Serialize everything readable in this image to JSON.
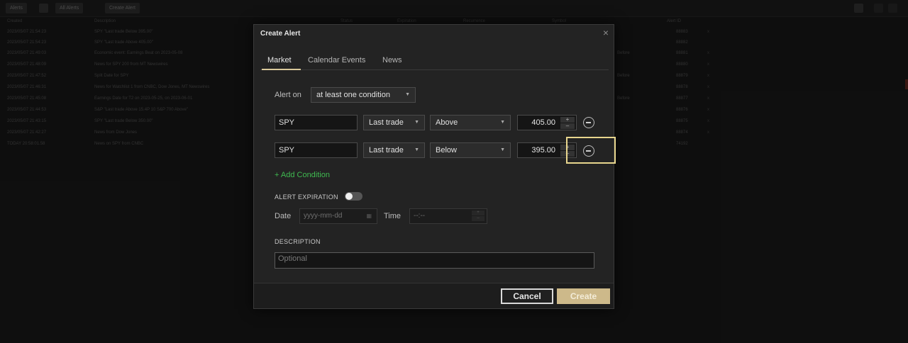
{
  "background": {
    "toolbar": {
      "menu_label": "Alerts",
      "filter_label": "All Alerts",
      "create_label": "Create Alert"
    },
    "headers": [
      "Created",
      "Description",
      "Status",
      "Expiration",
      "Recurrence",
      "Symbol",
      "Alert ID"
    ],
    "rows": [
      {
        "date": "2023/05/07 21:54:23",
        "desc": "SPY \"Last trade Below 395.00\"",
        "extra": "",
        "id": "88883",
        "mark": "x"
      },
      {
        "date": "2023/05/07 21:54:23",
        "desc": "SPY \"Last trade Above 405.00\"",
        "extra": "",
        "id": "88882",
        "mark": ""
      },
      {
        "date": "2023/05/07 21:49:03",
        "desc": "Economic event: Earnings Beat on 2023-05-08",
        "extra": "Before",
        "id": "88881",
        "mark": "x"
      },
      {
        "date": "2023/05/07 21:48:09",
        "desc": "News for SPY 200 from MT Newswires",
        "extra": "",
        "id": "88880",
        "mark": "x"
      },
      {
        "date": "2023/05/07 21:47:52",
        "desc": "Split Date for SPY",
        "extra": "Before",
        "id": "88879",
        "mark": "x"
      },
      {
        "date": "2023/05/07 21:46:31",
        "desc": "News for Watchlist 1 from CNBC, Dow Jones, MT Newswires",
        "extra": "",
        "id": "88878",
        "mark": "x"
      },
      {
        "date": "2023/05/07 21:45:08",
        "desc": "Earnings Date for T2 on 2023-05-25, on 2023-06-01",
        "extra": "Before",
        "id": "88877",
        "mark": "x"
      },
      {
        "date": "2023/05/07 21:44:53",
        "desc": "S&P \"Last trade Above 15.4P 10 S&P 700 Above\"",
        "extra": "",
        "id": "88876",
        "mark": "x"
      },
      {
        "date": "2023/05/07 21:43:15",
        "desc": "SPY \"Last trade Below 350.00\"",
        "extra": "",
        "id": "88875",
        "mark": "x"
      },
      {
        "date": "2023/05/07 21:42:27",
        "desc": "News from Dow Jones",
        "extra": "",
        "id": "88874",
        "mark": "x"
      },
      {
        "date": "TODAY 20:58:01.58",
        "desc": "News on SPY from CNBC",
        "extra": "",
        "id": "74192",
        "mark": ""
      }
    ]
  },
  "dialog": {
    "title": "Create Alert",
    "close_glyph": "×",
    "tabs": [
      "Market",
      "Calendar Events",
      "News"
    ],
    "active_tab": "Market",
    "alert_on": {
      "label": "Alert on",
      "value": "at least one condition"
    },
    "conditions": [
      {
        "symbol": "SPY",
        "field": "Last trade",
        "operator": "Above",
        "value": "405.00"
      },
      {
        "symbol": "SPY",
        "field": "Last trade",
        "operator": "Below",
        "value": "395.00"
      }
    ],
    "add_condition_label": "+ Add Condition",
    "expiration": {
      "title": "ALERT EXPIRATION",
      "enabled": false,
      "date_label": "Date",
      "date_placeholder": "yyyy-mm-dd",
      "time_label": "Time",
      "time_placeholder": "--:--"
    },
    "description": {
      "title": "DESCRIPTION",
      "placeholder": "Optional"
    },
    "buttons": {
      "cancel": "Cancel",
      "create": "Create"
    }
  },
  "colors": {
    "accent_gold": "#cdb98a",
    "highlight": "#e8d68e",
    "add_condition_green": "#3fb950",
    "dialog_bg": "#232323"
  },
  "icons": {
    "close": "close-icon",
    "caret": "chevron-down-icon",
    "remove": "minus-circle-icon",
    "calendar": "calendar-icon"
  }
}
